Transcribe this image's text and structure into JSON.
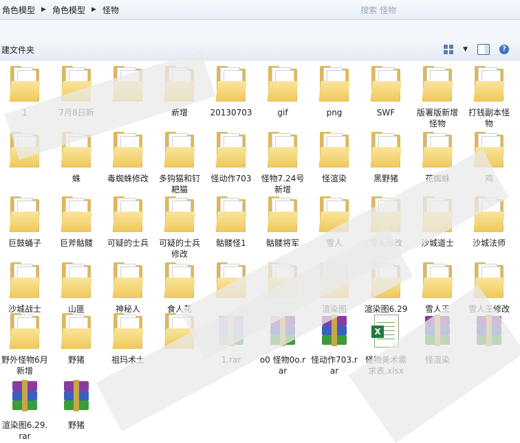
{
  "breadcrumb": [
    "角色模型",
    "角色模型",
    "怪物"
  ],
  "search_ghost": "搜索 怪物",
  "toolbar": {
    "new_folder": "建文件夹"
  },
  "help_icon_text": "?",
  "items": [
    {
      "type": "folder",
      "label": "1"
    },
    {
      "type": "folder",
      "label": "7月8日新"
    },
    {
      "type": "folder",
      "label": ""
    },
    {
      "type": "folder",
      "label": "新增"
    },
    {
      "type": "folder",
      "label": "20130703"
    },
    {
      "type": "folder",
      "label": "gif"
    },
    {
      "type": "folder",
      "label": "png"
    },
    {
      "type": "folder",
      "label": "SWF"
    },
    {
      "type": "folder",
      "label": "版署版新增怪物"
    },
    {
      "type": "folder",
      "label": "打钱副本怪物"
    },
    {
      "type": "folder",
      "label": ""
    },
    {
      "type": "folder",
      "label": "蛛"
    },
    {
      "type": "folder",
      "label": "毒蜘蛛修改"
    },
    {
      "type": "folder",
      "label": "多钩猫和钉耙猫"
    },
    {
      "type": "folder",
      "label": "怪动作703"
    },
    {
      "type": "folder",
      "label": "怪物7.24号新增"
    },
    {
      "type": "folder",
      "label": "怪渲染"
    },
    {
      "type": "folder",
      "label": "黑野猪"
    },
    {
      "type": "folder",
      "label": "花蜘蛛"
    },
    {
      "type": "folder",
      "label": "鸡"
    },
    {
      "type": "folder",
      "label": "巨鼓蛹子"
    },
    {
      "type": "folder",
      "label": "巨斧骷髅"
    },
    {
      "type": "folder",
      "label": "可疑的士兵"
    },
    {
      "type": "folder",
      "label": "可疑的士兵修改"
    },
    {
      "type": "folder",
      "label": "骷髅怪1"
    },
    {
      "type": "folder",
      "label": "骷髅将军"
    },
    {
      "type": "folder",
      "label": "雪人"
    },
    {
      "type": "folder",
      "label": "雪人修改"
    },
    {
      "type": "folder",
      "label": "沙城道士"
    },
    {
      "type": "folder",
      "label": "沙城法师"
    },
    {
      "type": "folder",
      "label": "沙城战士"
    },
    {
      "type": "folder",
      "label": "山匪"
    },
    {
      "type": "folder",
      "label": "神秘人"
    },
    {
      "type": "folder",
      "label": "食人花"
    },
    {
      "type": "folder",
      "label": ""
    },
    {
      "type": "folder",
      "label": ""
    },
    {
      "type": "folder",
      "label": "渲染图"
    },
    {
      "type": "folder",
      "label": "渲染图6.29"
    },
    {
      "type": "folder",
      "label": "雪人王"
    },
    {
      "type": "folder",
      "label": "雪人王修改"
    },
    {
      "type": "folder",
      "label": "野外怪物6月新增"
    },
    {
      "type": "folder",
      "label": "野猪"
    },
    {
      "type": "folder",
      "label": "祖玛术士"
    },
    {
      "type": "folder",
      "label": ""
    },
    {
      "type": "rar",
      "label": "1.rar"
    },
    {
      "type": "rar",
      "label": "o0 怪物0o.rar"
    },
    {
      "type": "rar",
      "label": "怪动作703.rar"
    },
    {
      "type": "xlsx",
      "label": "怪物美术需求表.xlsx"
    },
    {
      "type": "rar",
      "label": "怪渲染"
    },
    {
      "type": "rar",
      "label": ""
    },
    {
      "type": "rar",
      "label": "渲染图6.29.rar"
    },
    {
      "type": "rar",
      "label": "野猪"
    }
  ]
}
